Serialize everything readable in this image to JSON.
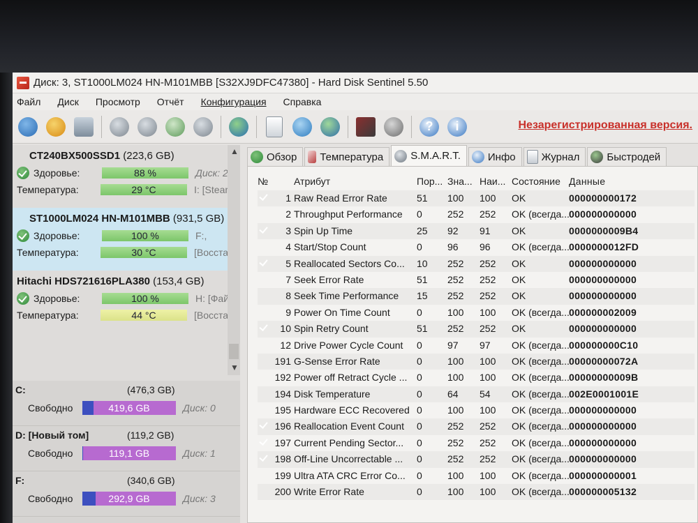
{
  "window": {
    "title": "Диск: 3, ST1000LM024 HN-M101MBB [S32XJ9DFC47380]  -  Hard Disk Sentinel 5.50"
  },
  "menu": [
    "Файл",
    "Диск",
    "Просмотр",
    "Отчёт",
    "Конфигурация",
    "Справка"
  ],
  "toolbar": {
    "icons": [
      "refresh-icon",
      "alert-icon",
      "disk-info-icon",
      "disk-test-1-icon",
      "disk-test-2-icon",
      "disk-test-3-icon",
      "disk-test-4-icon",
      "web-icon",
      "report-icon",
      "backup-icon",
      "network-icon",
      "settings-icon",
      "sound-icon",
      "help-icon",
      "info-icon"
    ],
    "unregistered": "Незарегистрированная версия."
  },
  "disks": [
    {
      "name": "CT240BX500SSD1",
      "size": "(223,6 GB)",
      "health_label": "Здоровье:",
      "health": "88 %",
      "health_extra": "Диск: 2",
      "temp_label": "Температура:",
      "temp": "29 °C",
      "temp_extra": "I: [Steam]"
    },
    {
      "name": "ST1000LM024 HN-M101MBB",
      "size": "(931,5 GB)",
      "health_label": "Здоровье:",
      "health": "100 %",
      "health_extra": "F:,",
      "temp_label": "Температура:",
      "temp": "30 °C",
      "temp_extra": "[Восстан"
    },
    {
      "name": "Hitachi HDS721616PLA380",
      "size": "(153,4 GB)",
      "health_label": "Здоровье:",
      "health": "100 %",
      "health_extra": "H: [Файл]",
      "temp_label": "Температура:",
      "temp": "44 °C",
      "temp_extra": "[Восстан"
    }
  ],
  "volumes": [
    {
      "name": "C:",
      "size": "(476,3 GB)",
      "free_label": "Свободно",
      "free": "419,6 GB",
      "free_fraction": 0.88,
      "disk": "Диск: 0"
    },
    {
      "name": "D: [Новый том]",
      "size": "(119,2 GB)",
      "free_label": "Свободно",
      "free": "119,1 GB",
      "free_fraction": 0.99,
      "disk": "Диск: 1"
    },
    {
      "name": "F:",
      "size": "(340,6 GB)",
      "free_label": "Свободно",
      "free": "292,9 GB",
      "free_fraction": 0.86,
      "disk": "Диск: 3"
    }
  ],
  "tabs": [
    "Обзор",
    "Температура",
    "S.M.A.R.T.",
    "Инфо",
    "Журнал",
    "Быстродей"
  ],
  "smart": {
    "headers": [
      "№",
      "Атрибут",
      "Пор...",
      "Зна...",
      "Наи...",
      "Состояние",
      "Данные"
    ],
    "rows": [
      {
        "check": true,
        "no": "1",
        "attr": "Raw Read Error Rate",
        "thr": "51",
        "val": "100",
        "worst": "100",
        "status": "OK",
        "data": "000000000172"
      },
      {
        "check": false,
        "no": "2",
        "attr": "Throughput Performance",
        "thr": "0",
        "val": "252",
        "worst": "252",
        "status": "OK (всегда...",
        "data": "000000000000"
      },
      {
        "check": true,
        "no": "3",
        "attr": "Spin Up Time",
        "thr": "25",
        "val": "92",
        "worst": "91",
        "status": "OK",
        "data": "0000000009B4"
      },
      {
        "check": false,
        "no": "4",
        "attr": "Start/Stop Count",
        "thr": "0",
        "val": "96",
        "worst": "96",
        "status": "OK (всегда...",
        "data": "0000000012FD"
      },
      {
        "check": true,
        "no": "5",
        "attr": "Reallocated Sectors Co...",
        "thr": "10",
        "val": "252",
        "worst": "252",
        "status": "OK",
        "data": "000000000000"
      },
      {
        "check": false,
        "no": "7",
        "attr": "Seek Error Rate",
        "thr": "51",
        "val": "252",
        "worst": "252",
        "status": "OK",
        "data": "000000000000"
      },
      {
        "check": false,
        "no": "8",
        "attr": "Seek Time Performance",
        "thr": "15",
        "val": "252",
        "worst": "252",
        "status": "OK",
        "data": "000000000000"
      },
      {
        "check": false,
        "no": "9",
        "attr": "Power On Time Count",
        "thr": "0",
        "val": "100",
        "worst": "100",
        "status": "OK (всегда...",
        "data": "000000002009"
      },
      {
        "check": true,
        "no": "10",
        "attr": "Spin Retry Count",
        "thr": "51",
        "val": "252",
        "worst": "252",
        "status": "OK",
        "data": "000000000000"
      },
      {
        "check": false,
        "no": "12",
        "attr": "Drive Power Cycle Count",
        "thr": "0",
        "val": "97",
        "worst": "97",
        "status": "OK (всегда...",
        "data": "000000000C10"
      },
      {
        "check": false,
        "no": "191",
        "attr": "G-Sense Error Rate",
        "thr": "0",
        "val": "100",
        "worst": "100",
        "status": "OK (всегда...",
        "data": "00000000072A"
      },
      {
        "check": false,
        "no": "192",
        "attr": "Power off Retract Cycle ...",
        "thr": "0",
        "val": "100",
        "worst": "100",
        "status": "OK (всегда...",
        "data": "00000000009B"
      },
      {
        "check": false,
        "no": "194",
        "attr": "Disk Temperature",
        "thr": "0",
        "val": "64",
        "worst": "54",
        "status": "OK (всегда...",
        "data": "002E0001001E"
      },
      {
        "check": false,
        "no": "195",
        "attr": "Hardware ECC Recovered",
        "thr": "0",
        "val": "100",
        "worst": "100",
        "status": "OK (всегда...",
        "data": "000000000000"
      },
      {
        "check": true,
        "no": "196",
        "attr": "Reallocation Event Count",
        "thr": "0",
        "val": "252",
        "worst": "252",
        "status": "OK (всегда...",
        "data": "000000000000"
      },
      {
        "check": true,
        "no": "197",
        "attr": "Current Pending Sector...",
        "thr": "0",
        "val": "252",
        "worst": "252",
        "status": "OK (всегда...",
        "data": "000000000000"
      },
      {
        "check": true,
        "no": "198",
        "attr": "Off-Line Uncorrectable ...",
        "thr": "0",
        "val": "252",
        "worst": "252",
        "status": "OK (всегда...",
        "data": "000000000000"
      },
      {
        "check": false,
        "no": "199",
        "attr": "Ultra ATA CRC Error Co...",
        "thr": "0",
        "val": "100",
        "worst": "100",
        "status": "OK (всегда...",
        "data": "000000000001"
      },
      {
        "check": false,
        "no": "200",
        "attr": "Write Error Rate",
        "thr": "0",
        "val": "100",
        "worst": "100",
        "status": "OK (всегда...",
        "data": "000000005132"
      }
    ]
  }
}
